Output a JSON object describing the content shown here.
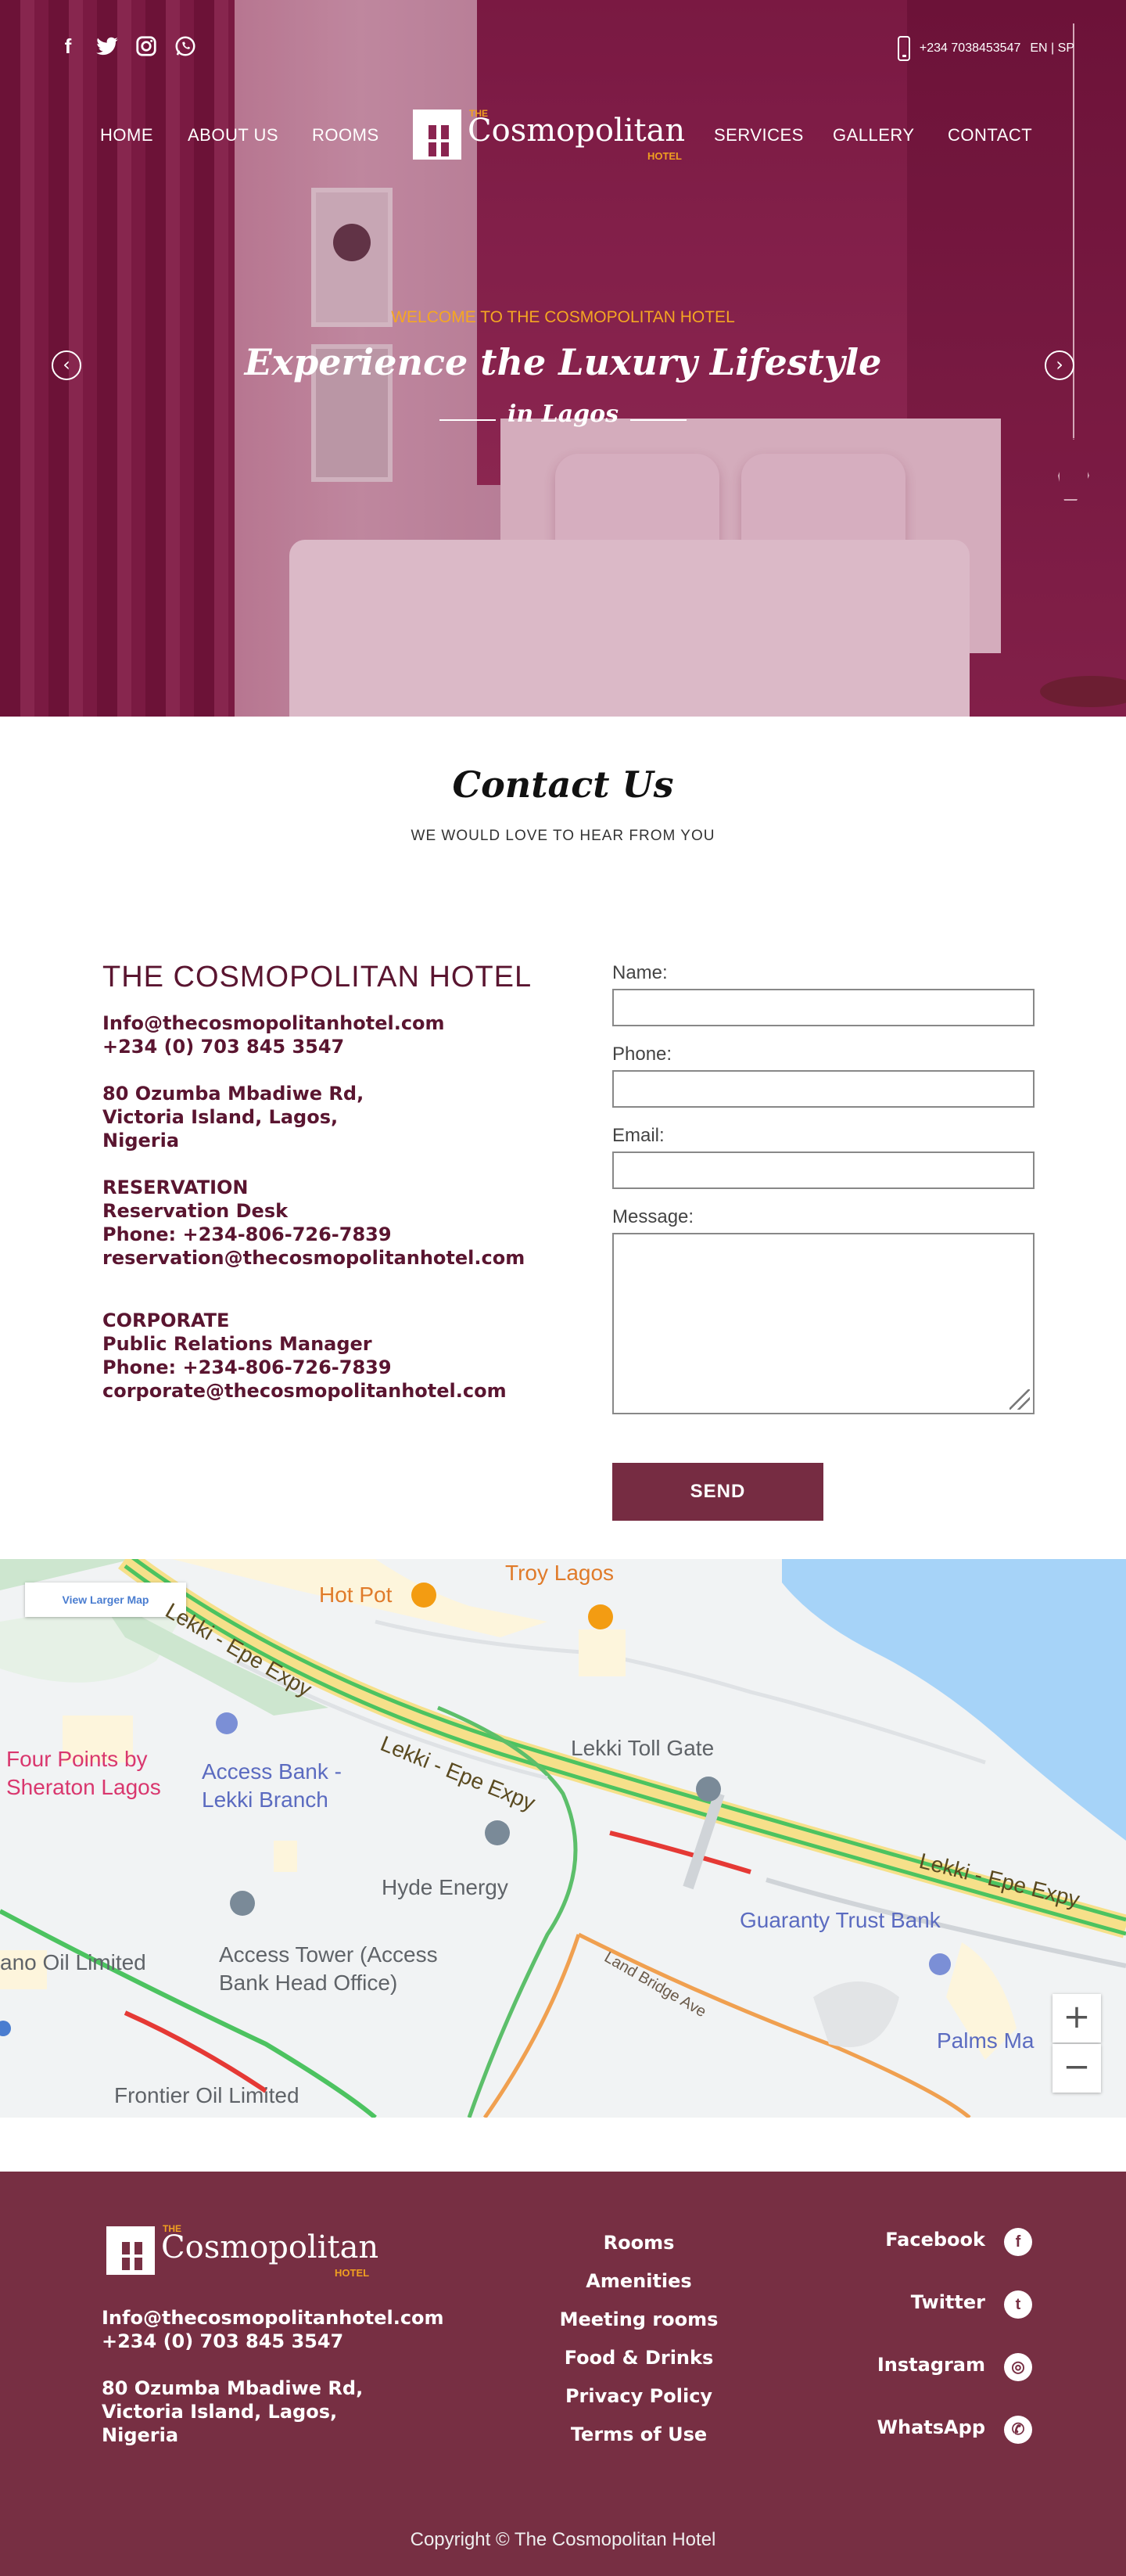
{
  "topbar": {
    "social_icons": [
      "facebook-icon",
      "twitter-icon",
      "instagram-icon",
      "whatsapp-icon"
    ],
    "phone": "+234 7038453547",
    "languages": "EN | SP"
  },
  "nav": {
    "left": [
      "HOME",
      "ABOUT US",
      "ROOMS"
    ],
    "right": [
      "SERVICES",
      "GALLERY",
      "CONTACT"
    ]
  },
  "logo": {
    "the": "THE",
    "name": "Cosmopolitan",
    "hotel": "HOTEL"
  },
  "hero": {
    "welcome": "WELCOME TO THE COSMOPOLITAN HOTEL",
    "title": "Experience the Luxury Lifestyle",
    "subtitle": "in Lagos",
    "prev": "‹",
    "next": "›"
  },
  "contact": {
    "title": "Contact Us",
    "subtitle": "WE WOULD LOVE TO HEAR FROM YOU",
    "hotel_name": "THE COSMOPOLITAN HOTEL",
    "email": "Info@thecosmopolitanhotel.com",
    "phone": "+234 (0) 703 845 3547",
    "address": [
      "80 Ozumba Mbadiwe Rd,",
      "Victoria Island, Lagos,",
      "Nigeria"
    ],
    "reservation": {
      "heading": "RESERVATION",
      "desk": "Reservation Desk",
      "phone": "Phone: +234-806-726-7839",
      "email": "reservation@thecosmopolitanhotel.com"
    },
    "corporate": {
      "heading": "CORPORATE",
      "desk": "Public Relations Manager",
      "phone": "Phone: +234-806-726-7839",
      "email": "corporate@thecosmopolitanhotel.com"
    }
  },
  "form": {
    "name_label": "Name:",
    "phone_label": "Phone:",
    "email_label": "Email:",
    "message_label": "Message:",
    "name_value": "",
    "phone_value": "",
    "email_value": "",
    "message_value": "",
    "send": "SEND"
  },
  "map": {
    "view_larger": "View Larger Map",
    "zoom_in": "+",
    "zoom_out": "−",
    "labels": {
      "hot_pot": "Hot Pot",
      "troy": "Troy Lagos",
      "expy1": "Lekki - Epe Expy",
      "expy2": "Lekki - Epe Expy",
      "expy3": "Lekki - Epe Expy",
      "four_points_1": "Four Points by",
      "four_points_2": "Sheraton Lagos",
      "access_1": "Access Bank -",
      "access_2": "Lekki Branch",
      "toll": "Lekki Toll Gate",
      "hyde": "Hyde Energy",
      "gtb": "Guaranty Trust Bank",
      "oil": "ano Oil Limited",
      "tower_1": "Access Tower (Access",
      "tower_2": "Bank Head Office)",
      "land": "Land Bridge Ave",
      "palms": "Palms Ma",
      "frontier": "Frontier Oil Limited"
    }
  },
  "footer": {
    "email": "Info@thecosmopolitanhotel.com",
    "phone": "+234 (0) 703 845 3547",
    "address": [
      "80 Ozumba Mbadiwe Rd,",
      "Victoria Island, Lagos,",
      "Nigeria"
    ],
    "links": [
      "Rooms",
      "Amenities",
      "Meeting rooms",
      "Food & Drinks",
      "Privacy Policy",
      "Terms of Use"
    ],
    "social": [
      {
        "label": "Facebook",
        "icon": "facebook-icon",
        "glyph": "f"
      },
      {
        "label": "Twitter",
        "icon": "twitter-icon",
        "glyph": "t"
      },
      {
        "label": "Instagram",
        "icon": "instagram-icon",
        "glyph": "◎"
      },
      {
        "label": "WhatsApp",
        "icon": "whatsapp-icon",
        "glyph": "✆"
      }
    ],
    "copyright": "Copyright ©  The Cosmopolitan Hotel"
  },
  "colors": {
    "brand": "#772f43",
    "accent": "#f5a722",
    "text": "#5a1530"
  }
}
